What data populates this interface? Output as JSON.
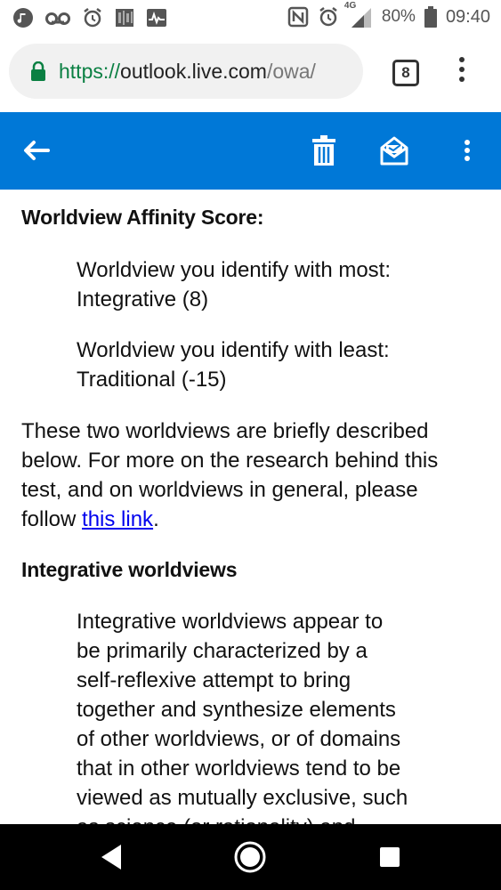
{
  "status_bar": {
    "left_icons": [
      "music-note-icon",
      "voicemail-icon",
      "alarm-clock-icon",
      "notification-app-icon",
      "activity-chart-icon"
    ],
    "right_icons": [
      "nfc-icon",
      "alarm-icon",
      "signal-4g-icon",
      "battery-icon"
    ],
    "network_label": "4G",
    "battery": "80%",
    "time": "09:40"
  },
  "browser": {
    "url_scheme": "https://",
    "url_host": "outlook.live.com",
    "url_path": "/owa/",
    "tab_count": "8"
  },
  "header": {
    "background": "#0078d7",
    "icons": [
      "back-arrow-icon",
      "trash-icon",
      "mark-read-envelope-icon",
      "more-vertical-icon"
    ]
  },
  "email": {
    "score_heading": "Worldview Affinity Score:",
    "most_label": "Worldview you identify with most:",
    "most_value": "Integrative (8)",
    "least_label": "Worldview you identify with least:",
    "least_value": "Traditional (-15)",
    "para_line1": "These two worldviews are briefly described",
    "para_line2": "below. For more on the research behind this",
    "para_line3": "test, and on worldviews in general, please",
    "para_follow": "follow ",
    "link_text": "this link",
    "para_end": ".",
    "section_heading": "Integrative worldviews",
    "section_lines": [
      "Integrative worldviews appear to",
      "be primarily characterized by a",
      "self-reflexive attempt to bring",
      "together and synthesize elements",
      "of other worldviews, or of domains",
      "that in other worldviews tend to be",
      "viewed as mutually exclusive, such",
      "as science (or rationality) and"
    ]
  },
  "nav_bar": {
    "icons": [
      "back-triangle-icon",
      "home-circle-icon",
      "recents-square-icon"
    ]
  }
}
